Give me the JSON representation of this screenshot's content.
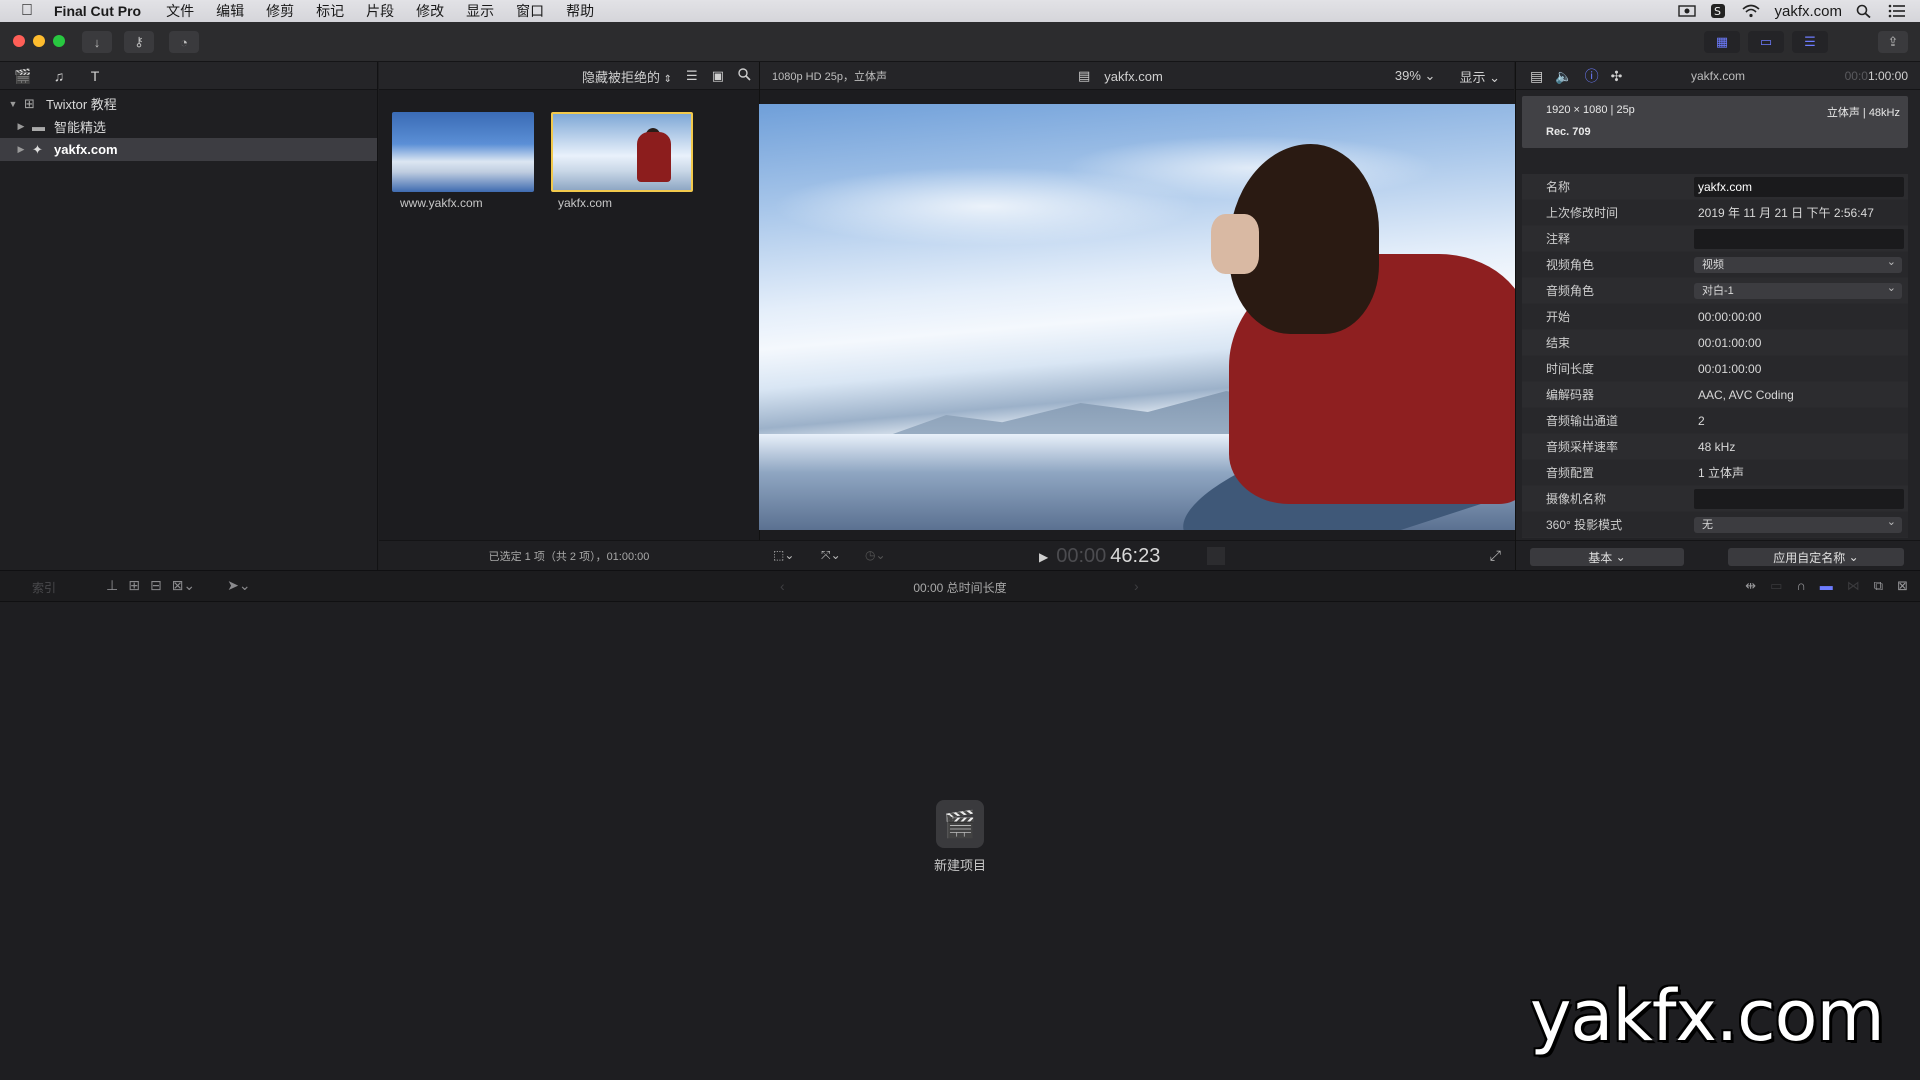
{
  "menubar": {
    "app_name": "Final Cut Pro",
    "menus": [
      "文件",
      "编辑",
      "修剪",
      "标记",
      "片段",
      "修改",
      "显示",
      "窗口",
      "帮助"
    ],
    "user": "yakfx.com"
  },
  "libraries": {
    "library_name": "Twixtor 教程",
    "items": [
      {
        "label": "智能精选"
      },
      {
        "label": "yakfx.com",
        "selected": true
      }
    ]
  },
  "browser": {
    "filter_label": "隐藏被拒绝的",
    "clips": [
      {
        "label": "www.yakfx.com"
      },
      {
        "label": "yakfx.com",
        "selected": true
      }
    ],
    "status": "已选定 1 项（共 2 项），01:00:00"
  },
  "viewer": {
    "format": "1080p HD 25p，立体声",
    "title": "yakfx.com",
    "zoom": "39%",
    "display_menu": "显示",
    "timecode_dim": "00:00",
    "timecode_main": "46:23"
  },
  "inspector": {
    "title": "yakfx.com",
    "duration_dim": "00:0",
    "duration_main": "1:00:00",
    "resolution": "1920 × 1080 | 25p",
    "audio_summary": "立体声 | 48kHz",
    "color_space": "Rec. 709",
    "rows": [
      {
        "key": "名称",
        "value": "yakfx.com",
        "type": "field"
      },
      {
        "key": "上次修改时间",
        "value": "2019 年 11 月 21 日 下午 2:56:47",
        "type": "text"
      },
      {
        "key": "注释",
        "value": "",
        "type": "field"
      },
      {
        "key": "视频角色",
        "value": "视频",
        "type": "pop"
      },
      {
        "key": "音频角色",
        "value": "对白-1",
        "type": "pop"
      },
      {
        "key": "开始",
        "value": "00:00:00:00",
        "type": "text"
      },
      {
        "key": "结束",
        "value": "00:01:00:00",
        "type": "text"
      },
      {
        "key": "时间长度",
        "value": "00:01:00:00",
        "type": "text"
      },
      {
        "key": "编解码器",
        "value": "AAC, AVC Coding",
        "type": "text"
      },
      {
        "key": "音频输出通道",
        "value": "2",
        "type": "text"
      },
      {
        "key": "音频采样速率",
        "value": "48 kHz",
        "type": "text"
      },
      {
        "key": "音频配置",
        "value": "1 立体声",
        "type": "text"
      },
      {
        "key": "摄像机名称",
        "value": "",
        "type": "field"
      },
      {
        "key": "360° 投影模式",
        "value": "无",
        "type": "pop"
      }
    ],
    "basic_button": "基本",
    "apply_button": "应用自定名称"
  },
  "timeline": {
    "index_label": "索引",
    "duration_label": "00:00 总时间长度",
    "new_project_label": "新建项目"
  },
  "watermark": "yakfx.com",
  "colors": {
    "accent": "#6d7cff",
    "selection_border": "#f2c94c"
  }
}
